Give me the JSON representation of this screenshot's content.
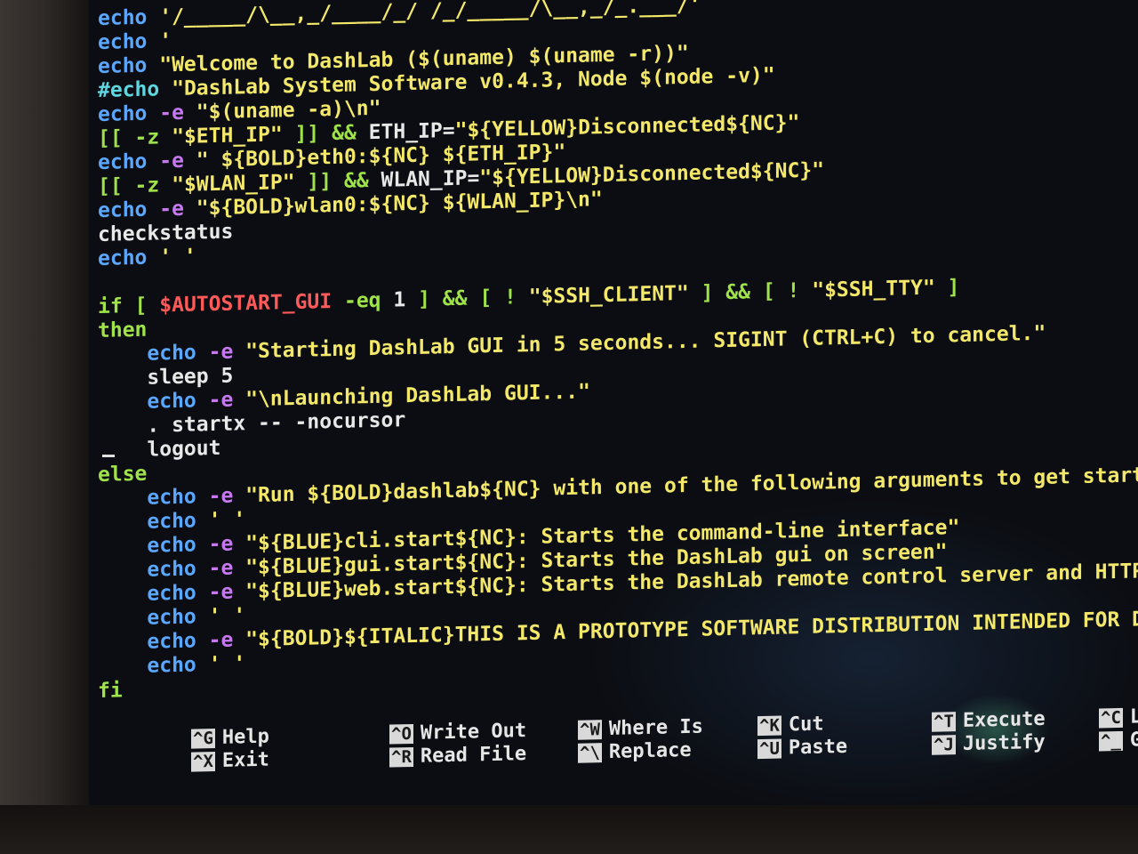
{
  "editor": {
    "lines": [
      {
        "parts": [
          {
            "t": "echo",
            "c": "echo"
          },
          {
            "t": " '/_____/\\__,_/____/_/ /_/_____/\\__,_/_.___/'",
            "c": "str"
          }
        ]
      },
      {
        "parts": [
          {
            "t": "echo",
            "c": "echo"
          },
          {
            "t": " '",
            "c": "str"
          }
        ]
      },
      {
        "parts": [
          {
            "t": "echo",
            "c": "echo"
          },
          {
            "t": " \"Welcome to DashLab ($(uname) $(uname -r))\"",
            "c": "str"
          }
        ]
      },
      {
        "parts": [
          {
            "t": "#echo",
            "c": "cyan"
          },
          {
            "t": " \"DashLab System Software v0.4.3, Node $(node -v)\"",
            "c": "str"
          }
        ]
      },
      {
        "parts": [
          {
            "t": "echo",
            "c": "echo"
          },
          {
            "t": " -e",
            "c": "flag"
          },
          {
            "t": " \"$(uname -a)\\n\"",
            "c": "str"
          }
        ]
      },
      {
        "parts": [
          {
            "t": "[[ -z ",
            "c": "green"
          },
          {
            "t": "\"$ETH_IP\"",
            "c": "str"
          },
          {
            "t": " ]] && ",
            "c": "green"
          },
          {
            "t": "ETH_IP=",
            "c": "plain"
          },
          {
            "t": "\"${YELLOW}Disconnected${NC}\"",
            "c": "str"
          }
        ]
      },
      {
        "parts": [
          {
            "t": "echo",
            "c": "echo"
          },
          {
            "t": " -e",
            "c": "flag"
          },
          {
            "t": " \" ${BOLD}eth0:${NC} ${ETH_IP}\"",
            "c": "str"
          }
        ]
      },
      {
        "parts": [
          {
            "t": "[[ -z ",
            "c": "green"
          },
          {
            "t": "\"$WLAN_IP\"",
            "c": "str"
          },
          {
            "t": " ]] && ",
            "c": "green"
          },
          {
            "t": "WLAN_IP=",
            "c": "plain"
          },
          {
            "t": "\"${YELLOW}Disconnected${NC}\"",
            "c": "str"
          }
        ]
      },
      {
        "parts": [
          {
            "t": "echo",
            "c": "echo"
          },
          {
            "t": " -e",
            "c": "flag"
          },
          {
            "t": " \"${BOLD}wlan0:${NC} ${WLAN_IP}\\n\"",
            "c": "str"
          }
        ]
      },
      {
        "parts": [
          {
            "t": "checkstatus",
            "c": "plain"
          }
        ]
      },
      {
        "parts": [
          {
            "t": "echo",
            "c": "echo"
          },
          {
            "t": " ' '",
            "c": "str"
          }
        ]
      },
      {
        "parts": [
          {
            "t": "",
            "c": "plain"
          }
        ]
      },
      {
        "parts": [
          {
            "t": "if [ ",
            "c": "green"
          },
          {
            "t": "$AUTOSTART_GUI",
            "c": "red"
          },
          {
            "t": " -eq ",
            "c": "green"
          },
          {
            "t": "1",
            "c": "plain"
          },
          {
            "t": " ] && [ ! ",
            "c": "green"
          },
          {
            "t": "\"$SSH_CLIENT\"",
            "c": "str"
          },
          {
            "t": " ] && [ ! ",
            "c": "green"
          },
          {
            "t": "\"$SSH_TTY\"",
            "c": "str"
          },
          {
            "t": " ]",
            "c": "green"
          }
        ]
      },
      {
        "parts": [
          {
            "t": "then",
            "c": "green"
          }
        ]
      },
      {
        "parts": [
          {
            "t": "    ",
            "c": "plain"
          },
          {
            "t": "echo",
            "c": "echo"
          },
          {
            "t": " -e",
            "c": "flag"
          },
          {
            "t": " \"Starting DashLab GUI in 5 seconds... SIGINT (CTRL+C) to cancel.\"",
            "c": "str"
          }
        ]
      },
      {
        "parts": [
          {
            "t": "    sleep 5",
            "c": "plain"
          }
        ]
      },
      {
        "parts": [
          {
            "t": "    ",
            "c": "plain"
          },
          {
            "t": "echo",
            "c": "echo"
          },
          {
            "t": " -e",
            "c": "flag"
          },
          {
            "t": " \"\\nLaunching DashLab GUI...\"",
            "c": "str"
          }
        ]
      },
      {
        "parts": [
          {
            "t": "    . startx -- -nocursor",
            "c": "plain"
          }
        ]
      },
      {
        "parts": [
          {
            "t": "    logout",
            "c": "plain"
          }
        ]
      },
      {
        "parts": [
          {
            "t": "else",
            "c": "green"
          }
        ]
      },
      {
        "parts": [
          {
            "t": "    ",
            "c": "plain"
          },
          {
            "t": "echo",
            "c": "echo"
          },
          {
            "t": " -e",
            "c": "flag"
          },
          {
            "t": " \"Run ${BOLD}dashlab${NC} with one of the following arguments to get started:\"",
            "c": "str"
          }
        ]
      },
      {
        "parts": [
          {
            "t": "    ",
            "c": "plain"
          },
          {
            "t": "echo",
            "c": "echo"
          },
          {
            "t": " ' '",
            "c": "str"
          }
        ]
      },
      {
        "parts": [
          {
            "t": "    ",
            "c": "plain"
          },
          {
            "t": "echo",
            "c": "echo"
          },
          {
            "t": " -e",
            "c": "flag"
          },
          {
            "t": " \"${BLUE}cli.start${NC}: Starts the command-line interface\"",
            "c": "str"
          }
        ]
      },
      {
        "parts": [
          {
            "t": "    ",
            "c": "plain"
          },
          {
            "t": "echo",
            "c": "echo"
          },
          {
            "t": " -e",
            "c": "flag"
          },
          {
            "t": " \"${BLUE}gui.start${NC}: Starts the DashLab gui on screen\"",
            "c": "str"
          }
        ]
      },
      {
        "parts": [
          {
            "t": "    ",
            "c": "plain"
          },
          {
            "t": "echo",
            "c": "echo"
          },
          {
            "t": " -e",
            "c": "flag"
          },
          {
            "t": " \"${BLUE}web.start${NC}: Starts the DashLab remote control server and HTTP API",
            "c": "str"
          }
        ]
      },
      {
        "parts": [
          {
            "t": "    ",
            "c": "plain"
          },
          {
            "t": "echo",
            "c": "echo"
          },
          {
            "t": " ' '",
            "c": "str"
          }
        ]
      },
      {
        "parts": [
          {
            "t": "    ",
            "c": "plain"
          },
          {
            "t": "echo",
            "c": "echo"
          },
          {
            "t": " -e",
            "c": "flag"
          },
          {
            "t": " \"${BOLD}${ITALIC}THIS IS A PROTOTYPE SOFTWARE DISTRIBUTION INTENDED FOR DEVEL",
            "c": "str"
          }
        ]
      },
      {
        "parts": [
          {
            "t": "    ",
            "c": "plain"
          },
          {
            "t": "echo",
            "c": "echo"
          },
          {
            "t": " ' '",
            "c": "str"
          }
        ]
      },
      {
        "parts": [
          {
            "t": "fi",
            "c": "green"
          }
        ]
      }
    ]
  },
  "shortcuts": [
    {
      "key1": "^G",
      "label1": "Help",
      "key2": "^X",
      "label2": "Exit"
    },
    {
      "key1": "^O",
      "label1": "Write Out",
      "key2": "^R",
      "label2": "Read File"
    },
    {
      "key1": "^W",
      "label1": "Where Is",
      "key2": "^\\",
      "label2": "Replace"
    },
    {
      "key1": "^K",
      "label1": "Cut",
      "key2": "^U",
      "label2": "Paste"
    },
    {
      "key1": "^T",
      "label1": "Execute",
      "key2": "^J",
      "label2": "Justify"
    },
    {
      "key1": "^C",
      "label1": "L",
      "key2": "^_",
      "label2": "G"
    }
  ],
  "colors": {
    "echo": "#5aa7ff",
    "flag": "#c678f0",
    "green": "#9fe24a",
    "red": "#ff5a5a",
    "str": "#f3e86a",
    "plain": "#e8e8e8",
    "cyan": "#5fd7e0"
  }
}
